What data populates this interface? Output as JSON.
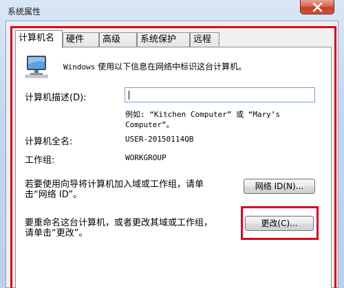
{
  "window": {
    "title": "系统属性"
  },
  "tabs": [
    "计算机名",
    "硬件",
    "高级",
    "系统保护",
    "远程"
  ],
  "intro": {
    "prefix": "Windows",
    "text": " 使用以下信息在网络中标识这台计算机。"
  },
  "description": {
    "label": "计算机描述(D):",
    "value": "",
    "example_line1": "例如: “Kitchen Computer” 或 “Mary’s",
    "example_line2": "Computer”。"
  },
  "full_name": {
    "label": "计算机全名:",
    "value": "USER-20150114QB"
  },
  "workgroup": {
    "label": "工作组:",
    "value": "WORKGROUP"
  },
  "network_id": {
    "text_line1": "若要使用向导将计算机加入域或工作组，请单",
    "text_line2": "击“网络 ID”。",
    "button_label": "网络 ID(N)..."
  },
  "rename": {
    "text_line1": "要重命名这台计算机，或者更改其域或工作组，",
    "text_line2": "请单击“更改”。",
    "button_label": "更改(C)..."
  },
  "icons": {
    "computer": "computer-icon",
    "close": "close-icon"
  },
  "colors": {
    "highlight": "#d9001b",
    "close": "#c4402a"
  }
}
